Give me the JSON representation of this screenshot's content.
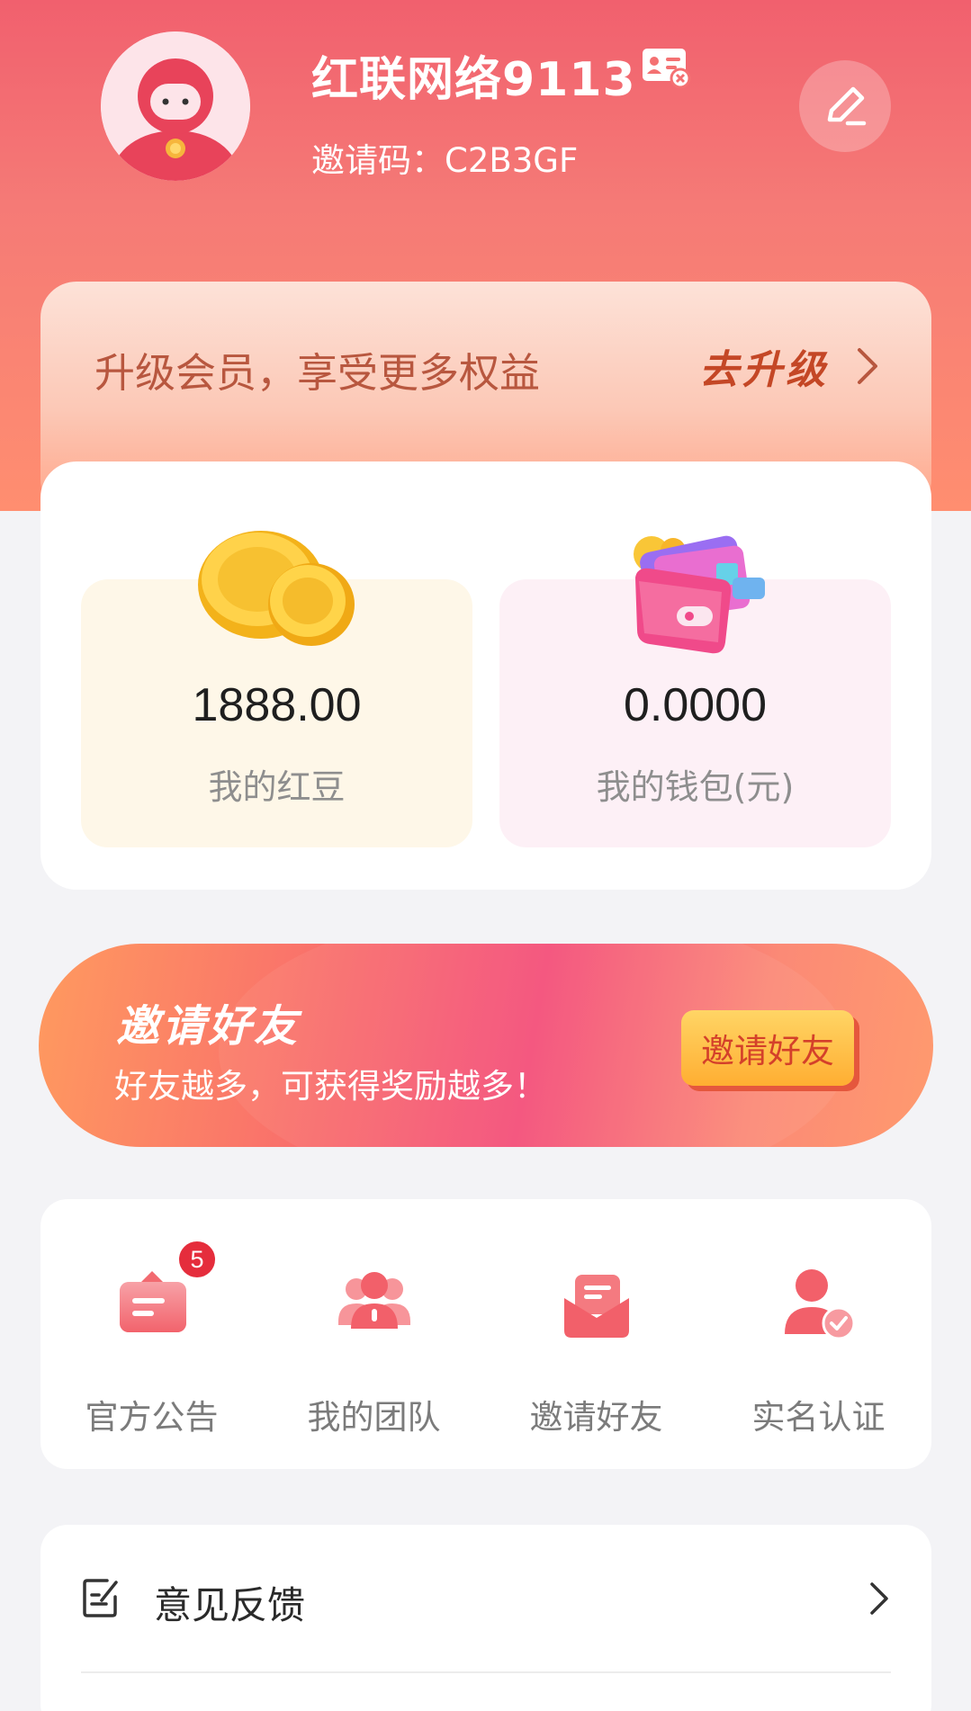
{
  "profile": {
    "username": "红联网络9113",
    "invite_label": "邀请码：",
    "invite_code": "C2B3GF",
    "avatar_icon": "avatar-icon",
    "id_card_icon": "id-card-icon",
    "edit_icon": "pencil-icon"
  },
  "upgrade": {
    "text": "升级会员，享受更多权益",
    "cta": "去升级",
    "chevron_icon": "chevron-right-icon"
  },
  "assets": {
    "beans": {
      "value": "1888.00",
      "label": "我的红豆",
      "icon": "gold-coins-icon"
    },
    "wallet": {
      "value": "0.0000",
      "label": "我的钱包(元)",
      "icon": "wallet-icon"
    }
  },
  "invite_banner": {
    "title": "邀请好友",
    "subtitle": "好友越多，可获得奖励越多！",
    "button": "邀请好友"
  },
  "shortcuts": [
    {
      "label": "官方公告",
      "icon": "announcement-icon",
      "badge": "5"
    },
    {
      "label": "我的团队",
      "icon": "team-icon"
    },
    {
      "label": "邀请好友",
      "icon": "invite-mail-icon"
    },
    {
      "label": "实名认证",
      "icon": "verified-user-icon"
    }
  ],
  "menu": {
    "items": [
      {
        "label": "意见反馈",
        "icon": "feedback-edit-icon"
      }
    ]
  },
  "colors": {
    "primary": "#f1606e",
    "accent_orange": "#ff8e70",
    "badge_red": "#e52d3c"
  }
}
